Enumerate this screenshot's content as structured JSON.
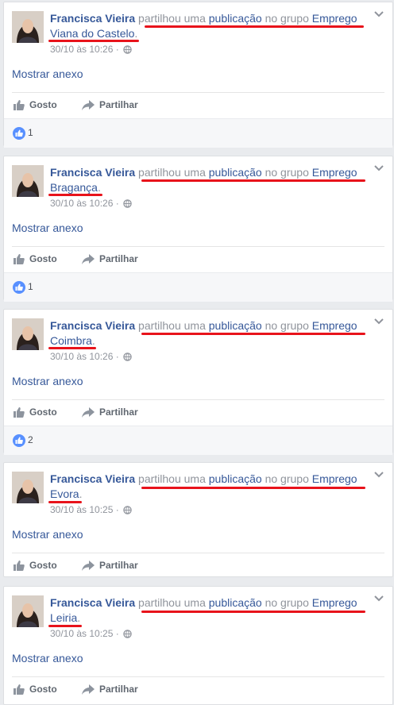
{
  "ui": {
    "like_label": "Gosto",
    "share_label": "Partilhar",
    "attachment_label": "Mostrar anexo",
    "icons": {
      "options": "chevron-down-icon",
      "privacy": "globe-icon",
      "like": "thumbs-up-icon",
      "share": "share-arrow-icon",
      "reaction": "like-reaction-icon"
    },
    "colors": {
      "link": "#365899",
      "muted": "#90949c",
      "like_blue": "#5890ff",
      "annotation": "#e8131b"
    }
  },
  "posts": [
    {
      "author": "Francisca Vieira",
      "action": "partilhou uma",
      "object": "publicação",
      "connector": "no grupo",
      "group": "Emprego Viana do Castelo",
      "time": "30/10 às 10:26",
      "likes": "1"
    },
    {
      "author": "Francisca Vieira",
      "action": "partilhou uma",
      "object": "publicação",
      "connector": "no grupo",
      "group": "Emprego Bragança",
      "time": "30/10 às 10:26",
      "likes": "1"
    },
    {
      "author": "Francisca Vieira",
      "action": "partilhou uma",
      "object": "publicação",
      "connector": "no grupo",
      "group": "Emprego Coimbra",
      "time": "30/10 às 10:26",
      "likes": "2"
    },
    {
      "author": "Francisca Vieira",
      "action": "partilhou uma",
      "object": "publicação",
      "connector": "no grupo",
      "group": "Emprego Evora",
      "time": "30/10 às 10:25",
      "likes": ""
    },
    {
      "author": "Francisca Vieira",
      "action": "partilhou uma",
      "object": "publicação",
      "connector": "no grupo",
      "group": "Emprego Leiria",
      "time": "30/10 às 10:25",
      "likes": ""
    }
  ]
}
